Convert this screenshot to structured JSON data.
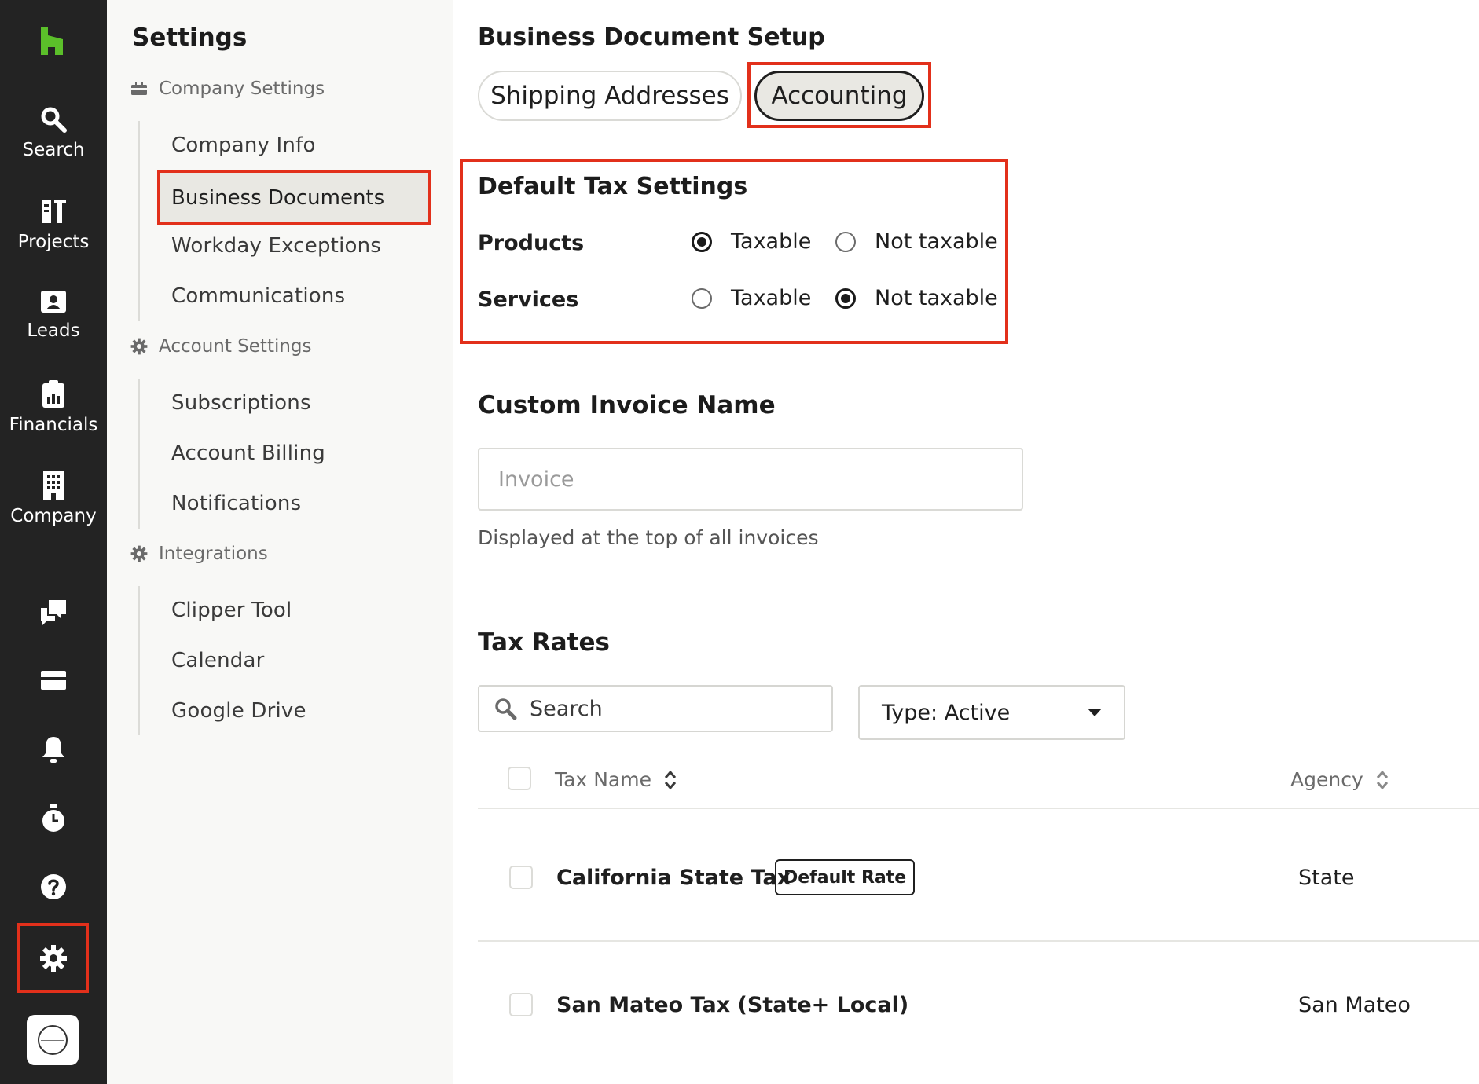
{
  "colors": {
    "rail_bg": "#232323",
    "sidebar_bg": "#f8f8f6",
    "highlight_outline": "#e2301b",
    "logo_green": "#5bbf2a",
    "active_bg": "#e9e8e3"
  },
  "rail": {
    "logo_icon": "houzz-logo-icon",
    "items": [
      {
        "label": "Search",
        "icon": "search-icon"
      },
      {
        "label": "Projects",
        "icon": "projects-icon"
      },
      {
        "label": "Leads",
        "icon": "leads-icon"
      },
      {
        "label": "Financials",
        "icon": "financials-icon"
      },
      {
        "label": "Company",
        "icon": "company-icon"
      }
    ],
    "bottom_icons": [
      "chat-icon",
      "inbox-icon",
      "bell-icon",
      "timer-icon",
      "help-icon",
      "gear-icon",
      "avatar-icon"
    ]
  },
  "sidebar": {
    "title": "Settings",
    "groups": [
      {
        "label": "Company Settings",
        "icon": "briefcase-icon",
        "items": [
          "Company Info",
          "Business Documents",
          "Workday Exceptions",
          "Communications"
        ]
      },
      {
        "label": "Account Settings",
        "icon": "gear-icon",
        "items": [
          "Subscriptions",
          "Account Billing",
          "Notifications"
        ]
      },
      {
        "label": "Integrations",
        "icon": "gear-icon",
        "items": [
          "Clipper Tool",
          "Calendar",
          "Google Drive"
        ]
      }
    ],
    "active_item": "Business Documents"
  },
  "main": {
    "title": "Business Document Setup",
    "tabs": [
      {
        "label": "Shipping Addresses",
        "selected": false
      },
      {
        "label": "Accounting",
        "selected": true
      }
    ],
    "tax_settings": {
      "title": "Default Tax Settings",
      "rows": [
        {
          "label": "Products",
          "options": [
            "Taxable",
            "Not taxable"
          ],
          "selected": "Taxable"
        },
        {
          "label": "Services",
          "options": [
            "Taxable",
            "Not taxable"
          ],
          "selected": "Not taxable"
        }
      ]
    },
    "invoice": {
      "title": "Custom Invoice Name",
      "placeholder": "Invoice",
      "value": "",
      "helper": "Displayed at the top of all invoices"
    },
    "tax_rates": {
      "title": "Tax Rates",
      "search_placeholder": "Search",
      "type_filter": "Type: Active",
      "columns": [
        "Tax Name",
        "Agency"
      ],
      "rows": [
        {
          "name": "California State Tax",
          "badge": "Default Rate",
          "agency": "State"
        },
        {
          "name": "San Mateo Tax (State+ Local)",
          "badge": "",
          "agency": "San Mateo"
        }
      ]
    }
  }
}
